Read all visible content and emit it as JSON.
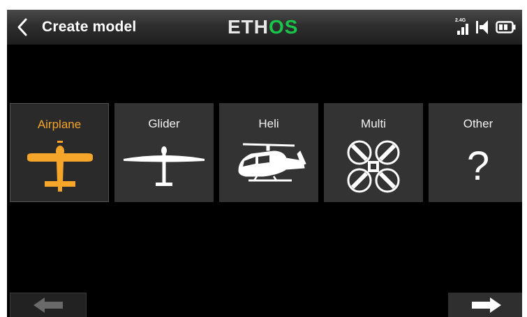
{
  "header": {
    "title": "Create model",
    "logo_part1": "ETH",
    "logo_part2": "OS",
    "rf_band": "2.4G",
    "logo_green": "#19c64a"
  },
  "model_types": [
    {
      "label": "Airplane",
      "icon": "airplane-icon",
      "selected": true
    },
    {
      "label": "Glider",
      "icon": "glider-icon",
      "selected": false
    },
    {
      "label": "Heli",
      "icon": "helicopter-icon",
      "selected": false
    },
    {
      "label": "Multi",
      "icon": "multirotor-icon",
      "selected": false
    },
    {
      "label": "Other",
      "icon": "question-mark-icon",
      "selected": false
    }
  ],
  "other_symbol": "?",
  "colors": {
    "selected_accent": "#f5a52a",
    "tile_bg": "#333333",
    "background": "#000000"
  },
  "navigation": {
    "prev_icon": "arrow-left-icon",
    "next_icon": "arrow-right-icon",
    "prev_enabled": false,
    "next_enabled": true
  }
}
